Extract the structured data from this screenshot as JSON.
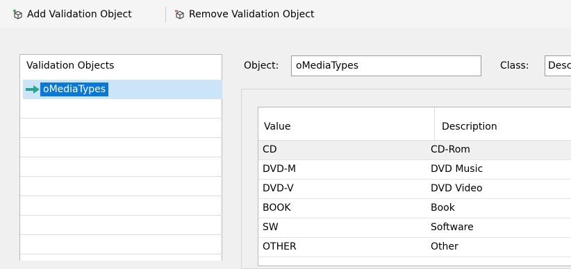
{
  "toolbar": {
    "add_label": "Add Validation Object",
    "remove_label": "Remove Validation Object"
  },
  "left_panel": {
    "header": "Validation Objects",
    "items": [
      {
        "label": "oMediaTypes",
        "selected": true
      }
    ]
  },
  "form": {
    "object_label": "Object:",
    "object_value": "oMediaTypes",
    "class_label": "Class:",
    "class_value": "Desc"
  },
  "grid": {
    "columns": [
      "Value",
      "Description"
    ],
    "rows": [
      {
        "value": "CD",
        "description": "CD-Rom"
      },
      {
        "value": "DVD-M",
        "description": "DVD Music"
      },
      {
        "value": "DVD-V",
        "description": "DVD Video"
      },
      {
        "value": "BOOK",
        "description": "Book"
      },
      {
        "value": "SW",
        "description": "Software"
      },
      {
        "value": "OTHER",
        "description": "Other"
      }
    ]
  },
  "colors": {
    "selection_fill": "#cce4f7",
    "selection_label": "#0a78d7",
    "arrow": "#2aa38f"
  },
  "icons": {
    "add": "add-object-icon",
    "remove": "remove-object-icon",
    "selected_item": "arrow-right-icon"
  }
}
